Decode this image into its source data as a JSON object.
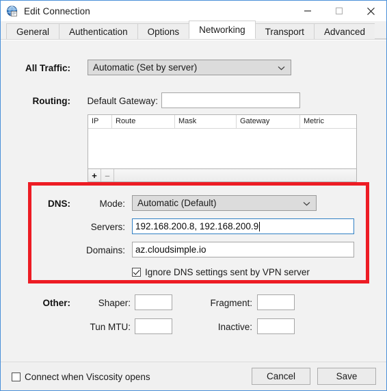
{
  "window": {
    "title": "Edit Connection",
    "icon": "globe-icon",
    "controls": {
      "minimize": "minimize-icon",
      "maximize": "maximize-icon",
      "close": "close-icon"
    }
  },
  "tabs": [
    {
      "label": "General",
      "active": false
    },
    {
      "label": "Authentication",
      "active": false
    },
    {
      "label": "Options",
      "active": false
    },
    {
      "label": "Networking",
      "active": true
    },
    {
      "label": "Transport",
      "active": false
    },
    {
      "label": "Advanced",
      "active": false
    }
  ],
  "all_traffic": {
    "label": "All Traffic:",
    "mode_value": "Automatic (Set by server)",
    "chevron": "chevron-down-icon"
  },
  "routing": {
    "label": "Routing:",
    "default_gateway_label": "Default Gateway:",
    "default_gateway_value": "",
    "default_gateway_placeholder": "",
    "columns": [
      "IP",
      "Route",
      "Mask",
      "Gateway",
      "Metric"
    ],
    "rows": [],
    "add_button": "+",
    "remove_button": "–"
  },
  "dns": {
    "label": "DNS:",
    "mode_label": "Mode:",
    "mode_value": "Automatic (Default)",
    "chevron": "chevron-down-icon",
    "servers_label": "Servers:",
    "servers_value": "192.168.200.8, 192.168.200.9",
    "servers_placeholder": "",
    "domains_label": "Domains:",
    "domains_value": "az.cloudsimple.io",
    "domains_placeholder": "",
    "ignore_label": "Ignore DNS settings sent by VPN server",
    "ignore_checked": true,
    "highlight_color": "#ed1c24"
  },
  "other": {
    "label": "Other:",
    "shaper_label": "Shaper:",
    "shaper_value": "",
    "fragment_label": "Fragment:",
    "fragment_value": "",
    "tun_mtu_label": "Tun MTU:",
    "tun_mtu_value": "",
    "inactive_label": "Inactive:",
    "inactive_value": ""
  },
  "footer": {
    "connect_label": "Connect when Viscosity opens",
    "connect_checked": false,
    "cancel_label": "Cancel",
    "save_label": "Save"
  },
  "colors": {
    "accent_border": "#4a90d9",
    "highlight": "#ed1c24",
    "focus_border": "#2f7fc4",
    "body_bg": "#f2f2f2"
  }
}
